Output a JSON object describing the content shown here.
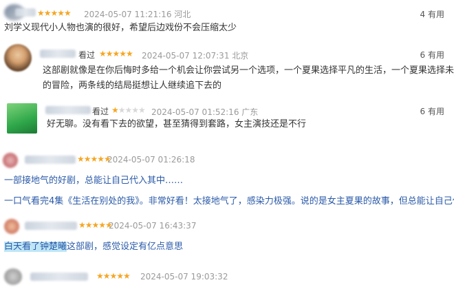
{
  "reviews": [
    {
      "stars": 5,
      "date": "2024-05-07 11:21:16",
      "location": "河北",
      "useful_count": "4",
      "useful_label": "有用",
      "lines": [
        "刘学义现代小人物也演的很好，希望后边戏份不会压缩太少"
      ]
    },
    {
      "seen": "看过",
      "stars": 5,
      "date": "2024-05-07 12:07:31",
      "location": "北京",
      "useful_count": "6",
      "useful_label": "有用",
      "lines": [
        "这部剧就像是在你后悔时多给一个机会让你尝试另一个选项，一个夏果选择平凡的生活，一个夏果选择未知",
        "的冒险，两条线的结局挺想让人继续追下去的"
      ]
    },
    {
      "seen": "看过",
      "stars": 1,
      "date": "2024-05-07 01:52:16",
      "location": "广东",
      "useful_count": "6",
      "useful_label": "有用",
      "lines": [
        "好无聊。没有看下去的欲望，甚至猜得到套路，女主演技还是不行"
      ]
    },
    {
      "stars": 5,
      "date": "2024-05-07 01:26:18",
      "lines": [
        "一部接地气的好剧，总能让自己代入其中……"
      ]
    },
    {
      "lines": [
        "一口气看完4集《生活在别处的我》。非常好看！太接地气了，感染力极强。说的是女主夏果的故事，但总能让自己代"
      ]
    },
    {
      "stars": 5,
      "date": "2024-05-07 16:43:37",
      "highlight": "白天看了钟楚曦",
      "rest": "这部剧，感觉设定有亿点意思"
    },
    {
      "stars": 5,
      "date": "2024-05-07 19:03:32"
    }
  ],
  "colors": {
    "star": "#f5a623",
    "meta": "#9a9a9a",
    "body_blue": "#2a5aa8",
    "highlight": "#bfe6f6"
  }
}
